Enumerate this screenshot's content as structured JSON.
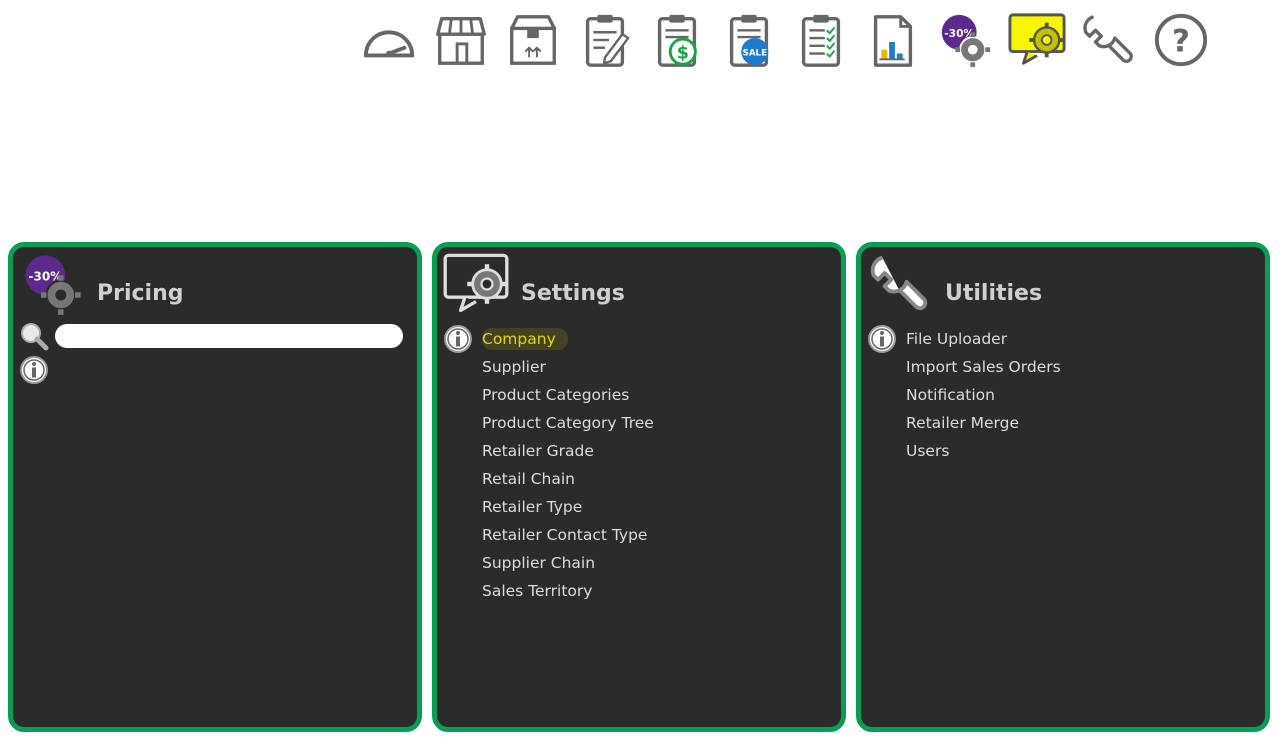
{
  "toolbar": {
    "items": [
      {
        "icon": "dashboard-gauge-icon"
      },
      {
        "icon": "store-icon"
      },
      {
        "icon": "package-box-icon"
      },
      {
        "icon": "clipboard-edit-icon"
      },
      {
        "icon": "clipboard-dollar-icon"
      },
      {
        "icon": "clipboard-sale-icon"
      },
      {
        "icon": "clipboard-checklist-icon"
      },
      {
        "icon": "report-chart-icon"
      },
      {
        "icon": "pricing-discount-gear-icon",
        "badge": "-30%"
      },
      {
        "icon": "settings-monitor-gear-icon",
        "active": true
      },
      {
        "icon": "wrench-icon"
      },
      {
        "icon": "help-icon"
      }
    ],
    "sale_badge": "SALE",
    "dollar_symbol": "$",
    "help_symbol": "?"
  },
  "colors": {
    "panel_border": "#0a9e52",
    "panel_bg": "#2b2b2b",
    "active_text": "#e0d800",
    "active_tool_bg": "#f6f600",
    "discount_purple": "#5b2a8c"
  },
  "pricing": {
    "title": "Pricing",
    "badge": "-30%",
    "search": {
      "value": "",
      "placeholder": ""
    }
  },
  "settings": {
    "title": "Settings",
    "items": [
      {
        "label": "Company",
        "active": true
      },
      {
        "label": "Supplier"
      },
      {
        "label": "Product Categories"
      },
      {
        "label": "Product Category Tree"
      },
      {
        "label": "Retailer Grade"
      },
      {
        "label": "Retail Chain"
      },
      {
        "label": "Retailer Type"
      },
      {
        "label": "Retailer Contact Type"
      },
      {
        "label": "Supplier Chain"
      },
      {
        "label": "Sales Territory"
      }
    ]
  },
  "utilities": {
    "title": "Utilities",
    "items": [
      {
        "label": "File Uploader"
      },
      {
        "label": "Import Sales Orders"
      },
      {
        "label": "Notification"
      },
      {
        "label": "Retailer Merge"
      },
      {
        "label": "Users"
      }
    ]
  }
}
